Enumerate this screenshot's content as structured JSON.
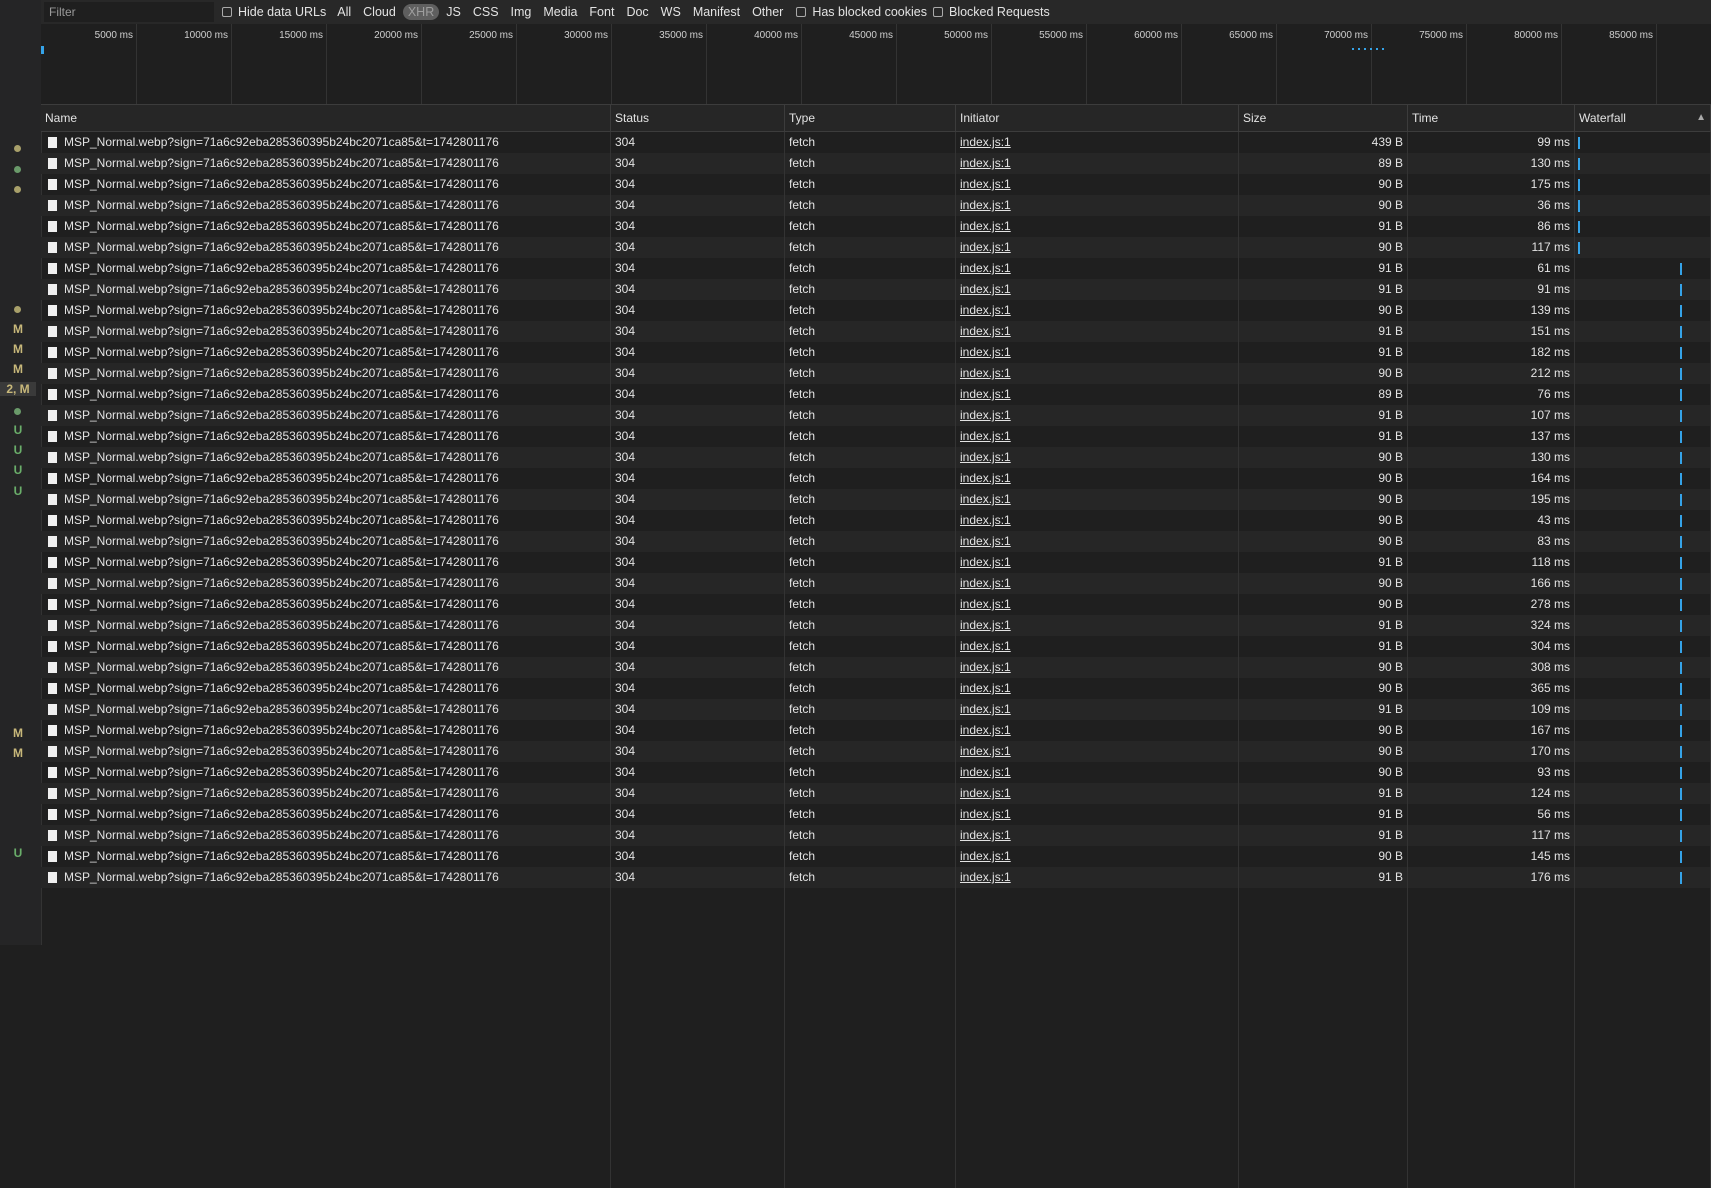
{
  "filter": {
    "placeholder": "Filter",
    "hide_data_urls": "Hide data URLs",
    "types": [
      "All",
      "Cloud",
      "XHR",
      "JS",
      "CSS",
      "Img",
      "Media",
      "Font",
      "Doc",
      "WS",
      "Manifest",
      "Other"
    ],
    "active_type": "XHR",
    "has_blocked_cookies": "Has blocked cookies",
    "blocked_requests": "Blocked Requests"
  },
  "overview": {
    "ticks": [
      "5000 ms",
      "10000 ms",
      "15000 ms",
      "20000 ms",
      "25000 ms",
      "30000 ms",
      "35000 ms",
      "40000 ms",
      "45000 ms",
      "50000 ms",
      "55000 ms",
      "60000 ms",
      "65000 ms",
      "70000 ms",
      "75000 ms",
      "80000 ms",
      "85000 ms"
    ]
  },
  "gutter": [
    {
      "type": "dot",
      "color": "#a8a06a"
    },
    {
      "type": "dot",
      "color": "#6a9a6a"
    },
    {
      "type": "dot",
      "color": "#a8a06a"
    },
    {
      "type": "dot",
      "color": "#a8a06a"
    },
    {
      "type": "text",
      "text": "M",
      "color": "#c8b87a"
    },
    {
      "type": "text",
      "text": "M",
      "color": "#c8b87a"
    },
    {
      "type": "text",
      "text": "M",
      "color": "#c8b87a"
    },
    {
      "type": "text",
      "text": "2, M",
      "color": "#c8b87a"
    },
    {
      "type": "dot",
      "color": "#6a9a6a"
    },
    {
      "type": "text",
      "text": "U",
      "color": "#6aae6a"
    },
    {
      "type": "text",
      "text": "U",
      "color": "#6aae6a"
    },
    {
      "type": "text",
      "text": "U",
      "color": "#6aae6a"
    },
    {
      "type": "text",
      "text": "U",
      "color": "#6aae6a"
    },
    {
      "type": "text",
      "text": "M",
      "color": "#c8b87a"
    },
    {
      "type": "text",
      "text": "M",
      "color": "#c8b87a"
    },
    {
      "type": "text",
      "text": "U",
      "color": "#6aae6a"
    }
  ],
  "columns": {
    "name": "Name",
    "status": "Status",
    "type": "Type",
    "initiator": "Initiator",
    "size": "Size",
    "time": "Time",
    "waterfall": "Waterfall",
    "sort_icon": "▲"
  },
  "requests": [
    {
      "name": "MSP_Normal.webp?sign=71a6c92eba285360395b24bc2071ca85&t=1742801176",
      "status": "304",
      "type": "fetch",
      "initiator": "index.js:1",
      "size": "439 B",
      "time": "99 ms"
    },
    {
      "name": "MSP_Normal.webp?sign=71a6c92eba285360395b24bc2071ca85&t=1742801176",
      "status": "304",
      "type": "fetch",
      "initiator": "index.js:1",
      "size": "89 B",
      "time": "130 ms"
    },
    {
      "name": "MSP_Normal.webp?sign=71a6c92eba285360395b24bc2071ca85&t=1742801176",
      "status": "304",
      "type": "fetch",
      "initiator": "index.js:1",
      "size": "90 B",
      "time": "175 ms"
    },
    {
      "name": "MSP_Normal.webp?sign=71a6c92eba285360395b24bc2071ca85&t=1742801176",
      "status": "304",
      "type": "fetch",
      "initiator": "index.js:1",
      "size": "90 B",
      "time": "36 ms"
    },
    {
      "name": "MSP_Normal.webp?sign=71a6c92eba285360395b24bc2071ca85&t=1742801176",
      "status": "304",
      "type": "fetch",
      "initiator": "index.js:1",
      "size": "91 B",
      "time": "86 ms"
    },
    {
      "name": "MSP_Normal.webp?sign=71a6c92eba285360395b24bc2071ca85&t=1742801176",
      "status": "304",
      "type": "fetch",
      "initiator": "index.js:1",
      "size": "90 B",
      "time": "117 ms"
    },
    {
      "name": "MSP_Normal.webp?sign=71a6c92eba285360395b24bc2071ca85&t=1742801176",
      "status": "304",
      "type": "fetch",
      "initiator": "index.js:1",
      "size": "91 B",
      "time": "61 ms"
    },
    {
      "name": "MSP_Normal.webp?sign=71a6c92eba285360395b24bc2071ca85&t=1742801176",
      "status": "304",
      "type": "fetch",
      "initiator": "index.js:1",
      "size": "91 B",
      "time": "91 ms"
    },
    {
      "name": "MSP_Normal.webp?sign=71a6c92eba285360395b24bc2071ca85&t=1742801176",
      "status": "304",
      "type": "fetch",
      "initiator": "index.js:1",
      "size": "90 B",
      "time": "139 ms"
    },
    {
      "name": "MSP_Normal.webp?sign=71a6c92eba285360395b24bc2071ca85&t=1742801176",
      "status": "304",
      "type": "fetch",
      "initiator": "index.js:1",
      "size": "91 B",
      "time": "151 ms"
    },
    {
      "name": "MSP_Normal.webp?sign=71a6c92eba285360395b24bc2071ca85&t=1742801176",
      "status": "304",
      "type": "fetch",
      "initiator": "index.js:1",
      "size": "91 B",
      "time": "182 ms"
    },
    {
      "name": "MSP_Normal.webp?sign=71a6c92eba285360395b24bc2071ca85&t=1742801176",
      "status": "304",
      "type": "fetch",
      "initiator": "index.js:1",
      "size": "90 B",
      "time": "212 ms"
    },
    {
      "name": "MSP_Normal.webp?sign=71a6c92eba285360395b24bc2071ca85&t=1742801176",
      "status": "304",
      "type": "fetch",
      "initiator": "index.js:1",
      "size": "89 B",
      "time": "76 ms"
    },
    {
      "name": "MSP_Normal.webp?sign=71a6c92eba285360395b24bc2071ca85&t=1742801176",
      "status": "304",
      "type": "fetch",
      "initiator": "index.js:1",
      "size": "91 B",
      "time": "107 ms"
    },
    {
      "name": "MSP_Normal.webp?sign=71a6c92eba285360395b24bc2071ca85&t=1742801176",
      "status": "304",
      "type": "fetch",
      "initiator": "index.js:1",
      "size": "91 B",
      "time": "137 ms"
    },
    {
      "name": "MSP_Normal.webp?sign=71a6c92eba285360395b24bc2071ca85&t=1742801176",
      "status": "304",
      "type": "fetch",
      "initiator": "index.js:1",
      "size": "90 B",
      "time": "130 ms"
    },
    {
      "name": "MSP_Normal.webp?sign=71a6c92eba285360395b24bc2071ca85&t=1742801176",
      "status": "304",
      "type": "fetch",
      "initiator": "index.js:1",
      "size": "90 B",
      "time": "164 ms"
    },
    {
      "name": "MSP_Normal.webp?sign=71a6c92eba285360395b24bc2071ca85&t=1742801176",
      "status": "304",
      "type": "fetch",
      "initiator": "index.js:1",
      "size": "90 B",
      "time": "195 ms"
    },
    {
      "name": "MSP_Normal.webp?sign=71a6c92eba285360395b24bc2071ca85&t=1742801176",
      "status": "304",
      "type": "fetch",
      "initiator": "index.js:1",
      "size": "90 B",
      "time": "43 ms"
    },
    {
      "name": "MSP_Normal.webp?sign=71a6c92eba285360395b24bc2071ca85&t=1742801176",
      "status": "304",
      "type": "fetch",
      "initiator": "index.js:1",
      "size": "90 B",
      "time": "83 ms"
    },
    {
      "name": "MSP_Normal.webp?sign=71a6c92eba285360395b24bc2071ca85&t=1742801176",
      "status": "304",
      "type": "fetch",
      "initiator": "index.js:1",
      "size": "91 B",
      "time": "118 ms"
    },
    {
      "name": "MSP_Normal.webp?sign=71a6c92eba285360395b24bc2071ca85&t=1742801176",
      "status": "304",
      "type": "fetch",
      "initiator": "index.js:1",
      "size": "90 B",
      "time": "166 ms"
    },
    {
      "name": "MSP_Normal.webp?sign=71a6c92eba285360395b24bc2071ca85&t=1742801176",
      "status": "304",
      "type": "fetch",
      "initiator": "index.js:1",
      "size": "90 B",
      "time": "278 ms"
    },
    {
      "name": "MSP_Normal.webp?sign=71a6c92eba285360395b24bc2071ca85&t=1742801176",
      "status": "304",
      "type": "fetch",
      "initiator": "index.js:1",
      "size": "91 B",
      "time": "324 ms"
    },
    {
      "name": "MSP_Normal.webp?sign=71a6c92eba285360395b24bc2071ca85&t=1742801176",
      "status": "304",
      "type": "fetch",
      "initiator": "index.js:1",
      "size": "91 B",
      "time": "304 ms"
    },
    {
      "name": "MSP_Normal.webp?sign=71a6c92eba285360395b24bc2071ca85&t=1742801176",
      "status": "304",
      "type": "fetch",
      "initiator": "index.js:1",
      "size": "90 B",
      "time": "308 ms"
    },
    {
      "name": "MSP_Normal.webp?sign=71a6c92eba285360395b24bc2071ca85&t=1742801176",
      "status": "304",
      "type": "fetch",
      "initiator": "index.js:1",
      "size": "90 B",
      "time": "365 ms"
    },
    {
      "name": "MSP_Normal.webp?sign=71a6c92eba285360395b24bc2071ca85&t=1742801176",
      "status": "304",
      "type": "fetch",
      "initiator": "index.js:1",
      "size": "91 B",
      "time": "109 ms"
    },
    {
      "name": "MSP_Normal.webp?sign=71a6c92eba285360395b24bc2071ca85&t=1742801176",
      "status": "304",
      "type": "fetch",
      "initiator": "index.js:1",
      "size": "90 B",
      "time": "167 ms"
    },
    {
      "name": "MSP_Normal.webp?sign=71a6c92eba285360395b24bc2071ca85&t=1742801176",
      "status": "304",
      "type": "fetch",
      "initiator": "index.js:1",
      "size": "90 B",
      "time": "170 ms"
    },
    {
      "name": "MSP_Normal.webp?sign=71a6c92eba285360395b24bc2071ca85&t=1742801176",
      "status": "304",
      "type": "fetch",
      "initiator": "index.js:1",
      "size": "90 B",
      "time": "93 ms"
    },
    {
      "name": "MSP_Normal.webp?sign=71a6c92eba285360395b24bc2071ca85&t=1742801176",
      "status": "304",
      "type": "fetch",
      "initiator": "index.js:1",
      "size": "91 B",
      "time": "124 ms"
    },
    {
      "name": "MSP_Normal.webp?sign=71a6c92eba285360395b24bc2071ca85&t=1742801176",
      "status": "304",
      "type": "fetch",
      "initiator": "index.js:1",
      "size": "91 B",
      "time": "56 ms"
    },
    {
      "name": "MSP_Normal.webp?sign=71a6c92eba285360395b24bc2071ca85&t=1742801176",
      "status": "304",
      "type": "fetch",
      "initiator": "index.js:1",
      "size": "91 B",
      "time": "117 ms"
    },
    {
      "name": "MSP_Normal.webp?sign=71a6c92eba285360395b24bc2071ca85&t=1742801176",
      "status": "304",
      "type": "fetch",
      "initiator": "index.js:1",
      "size": "90 B",
      "time": "145 ms"
    },
    {
      "name": "MSP_Normal.webp?sign=71a6c92eba285360395b24bc2071ca85&t=1742801176",
      "status": "304",
      "type": "fetch",
      "initiator": "index.js:1",
      "size": "91 B",
      "time": "176 ms"
    }
  ],
  "colors": {
    "accent": "#35a3e8",
    "background": "#1f1f1f"
  }
}
